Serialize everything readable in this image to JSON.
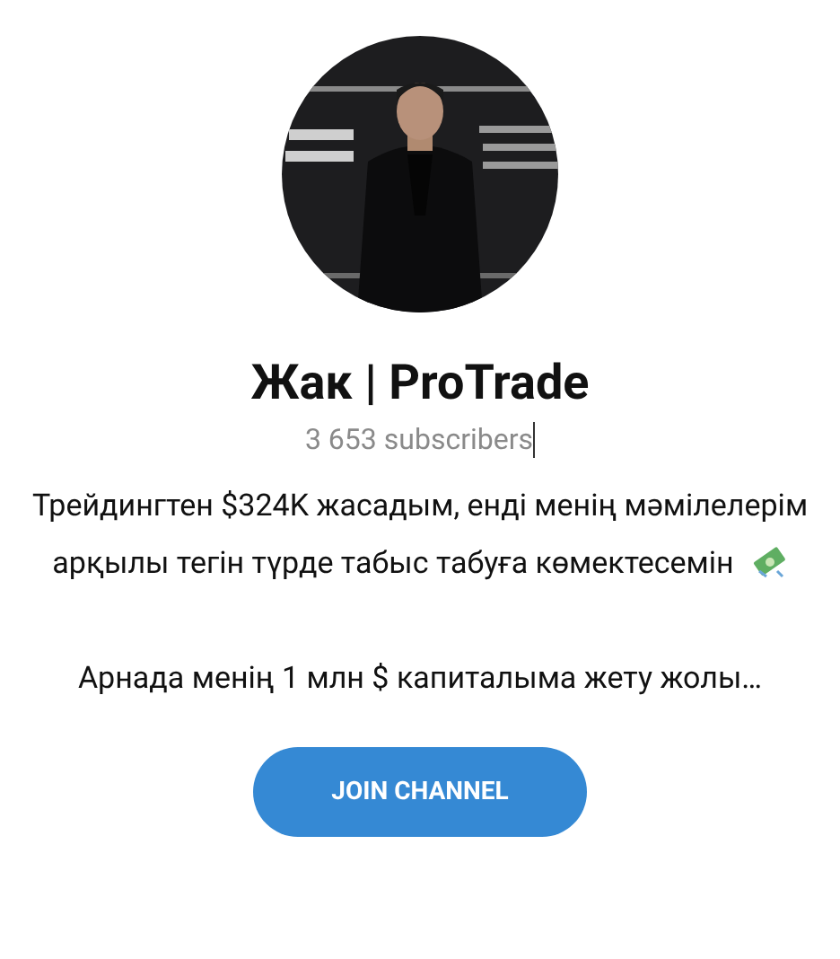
{
  "channel": {
    "title": "Жак | ProTrade",
    "subscribers": "3 653 subscribers",
    "description": [
      "Трейдингтен $324K жасадым, енді менің мәмілелерім арқылы тегін түрде табыс табуға көмектесемін",
      "Арнада менің 1 млн $ капиталыма жету жолы…"
    ]
  },
  "button": {
    "label": "JOIN CHANNEL"
  }
}
